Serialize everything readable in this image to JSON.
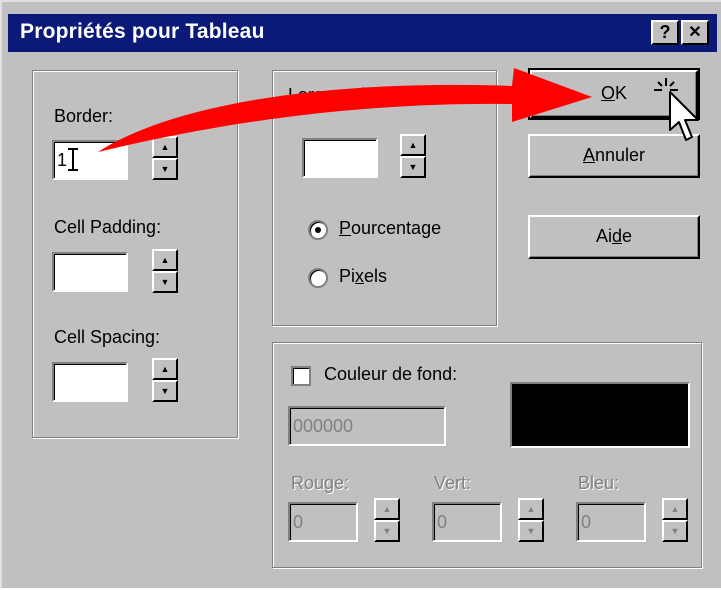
{
  "window": {
    "title": "Propriétés pour Tableau",
    "help_glyph": "?",
    "close_glyph": "✕"
  },
  "left_group": {
    "border_label": "Border:",
    "border_value": "1",
    "cell_padding_label": "Cell Padding:",
    "cell_padding_value": "",
    "cell_spacing_label": "Cell Spacing:",
    "cell_spacing_value": ""
  },
  "width_group": {
    "label_visible": "Largeur du tableau",
    "width_value": "",
    "radio_percent_pre": "",
    "radio_percent_key": "P",
    "radio_percent_post": "ourcentage",
    "radio_pixels_pre": "Pi",
    "radio_pixels_key": "x",
    "radio_pixels_post": "els",
    "selected": "Pourcentage"
  },
  "buttons": {
    "ok_key": "O",
    "ok_rest": "K",
    "cancel_key": "A",
    "cancel_rest": "nnuler",
    "help_pre": "Ai",
    "help_key": "d",
    "help_post": "e"
  },
  "color_group": {
    "checkbox_label": "Couleur de fond:",
    "hex_value": "000000",
    "swatch_color": "#000000",
    "red_label": "Rouge:",
    "red_value": "0",
    "green_label": "Vert:",
    "green_value": "0",
    "blue_label": "Bleu:",
    "blue_value": "0"
  },
  "spinner": {
    "up": "▲",
    "down": "▼"
  },
  "annotation": {
    "arrow_color": "#ff0000"
  }
}
